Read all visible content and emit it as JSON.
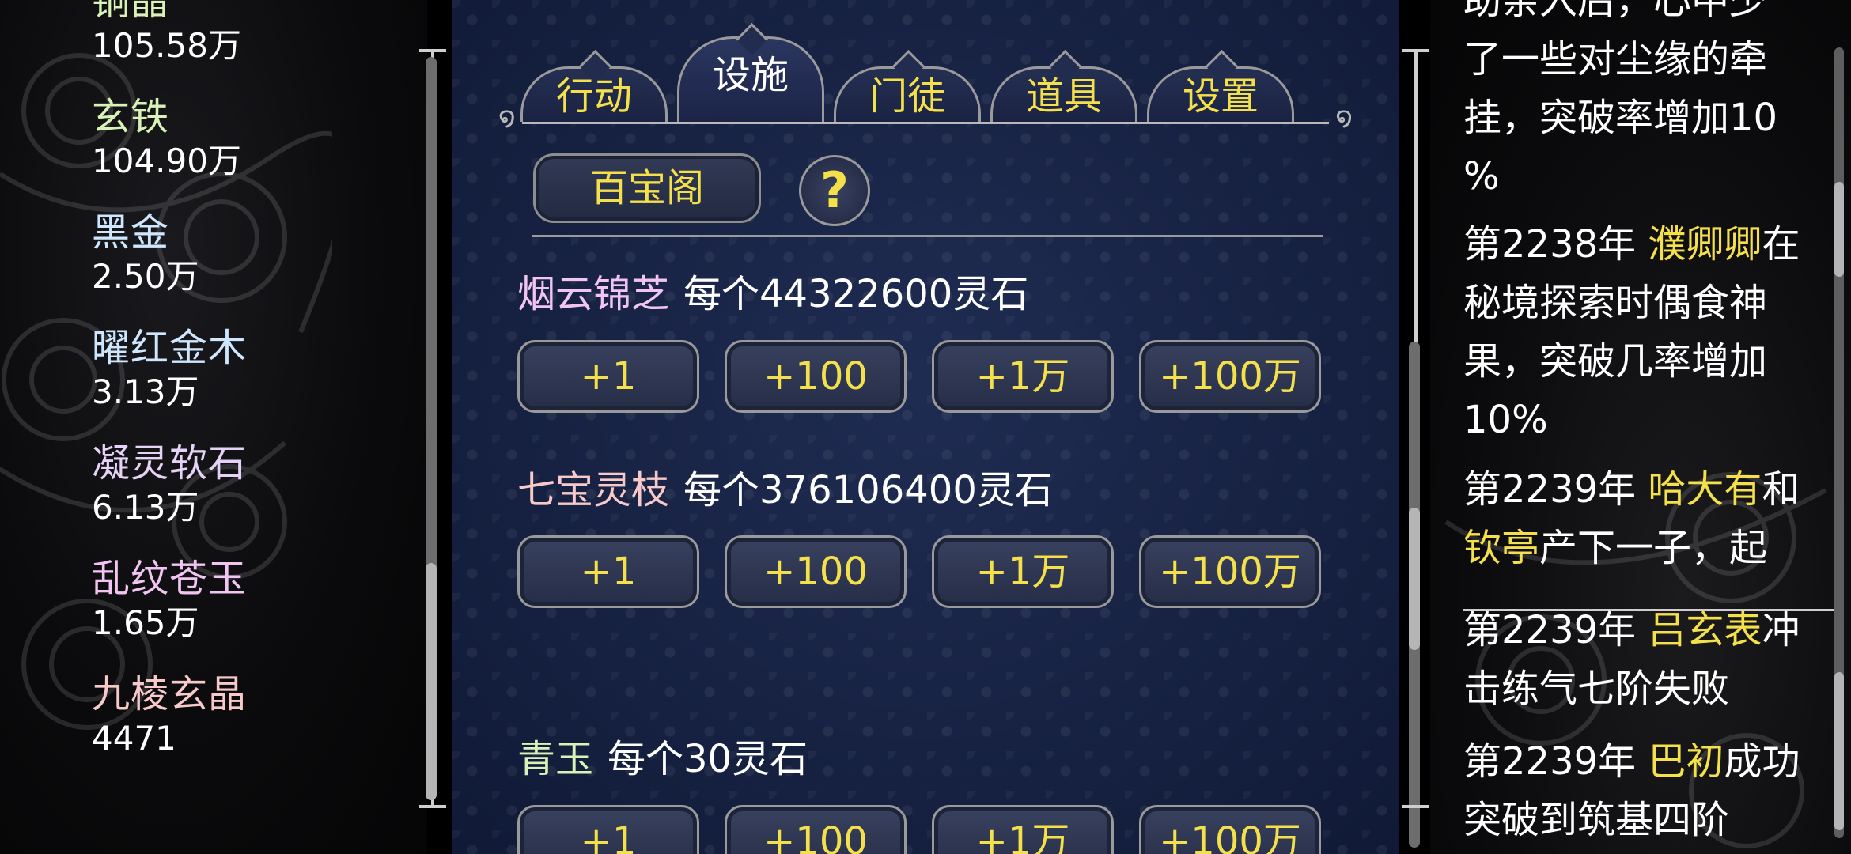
{
  "resources": [
    {
      "name": "铜晶",
      "value": "105.58万",
      "color": "#d9f2b8"
    },
    {
      "name": "玄铁",
      "value": "104.90万",
      "color": "#d9f2b8"
    },
    {
      "name": "黑金",
      "value": "2.50万",
      "color": "#cfe6ff"
    },
    {
      "name": "曜红金木",
      "value": "3.13万",
      "color": "#cfe6ff"
    },
    {
      "name": "凝灵软石",
      "value": "6.13万",
      "color": "#e6d2f7"
    },
    {
      "name": "乱纹苍玉",
      "value": "1.65万",
      "color": "#f2c4f2"
    },
    {
      "name": "九棱玄晶",
      "value": "4471",
      "color": "#f7c9c9"
    }
  ],
  "tabs": [
    {
      "label": "行动",
      "active": false
    },
    {
      "label": "设施",
      "active": true
    },
    {
      "label": "门徒",
      "active": false
    },
    {
      "label": "道具",
      "active": false
    },
    {
      "label": "设置",
      "active": false
    }
  ],
  "shop": {
    "title_button": "百宝阁",
    "help_label": "?",
    "items": [
      {
        "name": "烟云锦芝",
        "name_color": "#f2c4f2",
        "price": "每个44322600灵石"
      },
      {
        "name": "七宝灵枝",
        "name_color": "#f7c9c9",
        "price": "每个376106400灵石"
      },
      {
        "name": "青玉",
        "name_color": "#d9f2b8",
        "price": "每个30灵石"
      }
    ],
    "buy_buttons": [
      "+1",
      "+100",
      "+1万",
      "+100万"
    ]
  },
  "log": {
    "partial_top": [
      "助亲入后，心中少",
      "了一些对尘缘的牵",
      "挂，突破率增加10",
      "%"
    ],
    "entries": [
      {
        "prefix": "第2238年 ",
        "name": "濮卿卿",
        "rest_first": "在",
        "lines": [
          "秘境探索时偶食神",
          "果，突破几率增加",
          "10%"
        ]
      },
      {
        "prefix": "第2239年 ",
        "name": "哈大有",
        "rest_first": "和",
        "name2": "钦亭",
        "rest2": "产下一子，起"
      },
      {
        "prefix": "第2239年 ",
        "name": "吕玄表",
        "rest_first": "冲",
        "lines": [
          "击练气七阶失败"
        ]
      },
      {
        "prefix": "第2239年 ",
        "name": "巴初",
        "rest_first": "成功",
        "lines": [
          "突破到筑基四阶"
        ]
      }
    ]
  }
}
